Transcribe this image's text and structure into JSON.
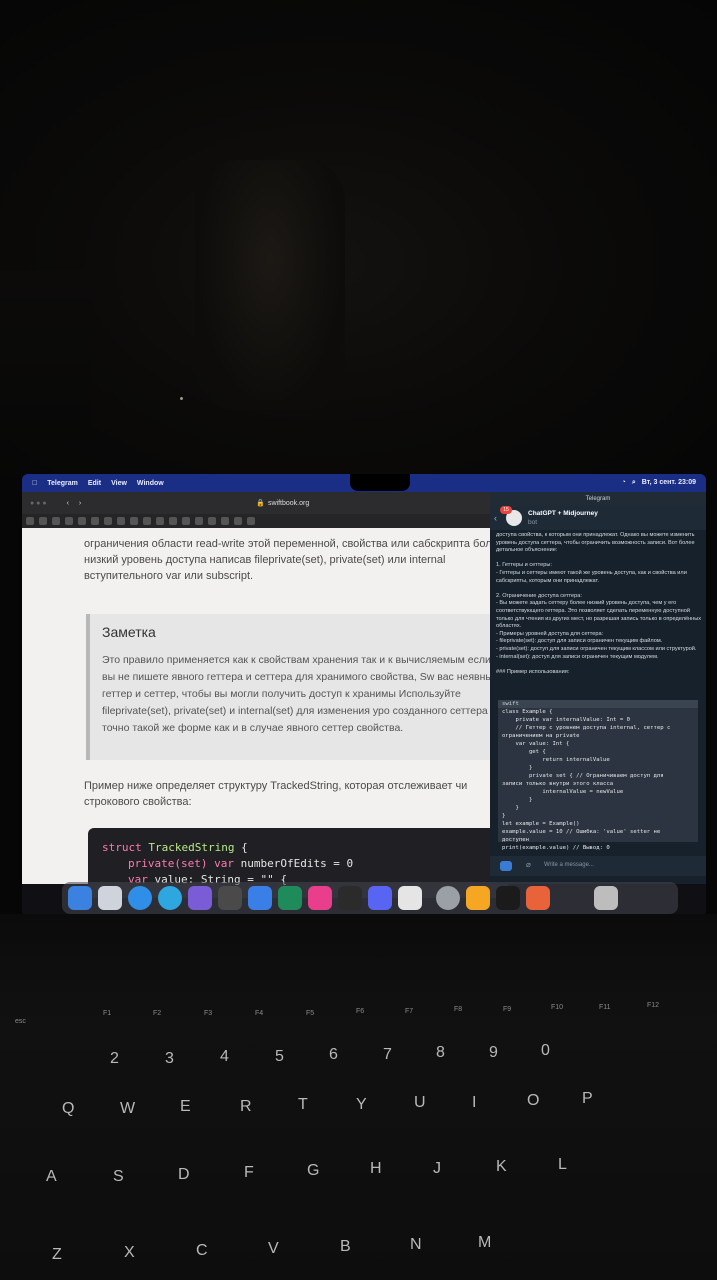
{
  "menubar": {
    "app": "Telegram",
    "items": [
      "Edit",
      "View",
      "Window"
    ],
    "clock": "Вт, 3 сент.  23:09"
  },
  "browser": {
    "url": "swiftbook.org",
    "paragraph1": "ограничения области read-write этой переменной, свойства или сабскрипта более низкий уровень доступа написав fileprivate(set), private(set) или internal вступительного var или subscript.",
    "note_title": "Заметка",
    "note_body": "Это правило применяется как к свойствам хранения так и к вычисляемым если вы не пишете явного геттера и сеттера для хранимого свойства, Sw вас неявный геттер и сеттер, чтобы вы могли получить доступ к хранимы Используйте fileprivate(set), private(set) и internal(set) для изменения уро созданного сеттера в точно такой же форме как и в случае явного сеттер свойства.",
    "paragraph2": "Пример ниже определяет структуру TrackedString, которая отслеживает чи строкового свойства:",
    "code": {
      "line1_kw": "struct",
      "line1_type": "TrackedString",
      "line1_end": "{",
      "line2_kw": "private(set) var",
      "line2_rest": "numberOfEdits = 0",
      "line3_kw": "var",
      "line3_rest": "value: String = \"\" {"
    }
  },
  "telegram": {
    "window_title": "Telegram",
    "chat_name": "ChatGPT + Midjourney",
    "chat_status": "bot",
    "badge": "15",
    "message": "доступа свойства, к которым они принадлежат. Однако вы можете изменить уровень доступа сеттера, чтобы ограничить возможность записи. Вот более детальное объяснение:\n\n1. Геттеры и сеттеры:\n - Геттеры и сеттеры имеют такой же уровень доступа, как и свойства или сабскрипты, которым они принадлежат.\n\n2. Ограничение доступа сеттера:\n - Вы можете задать сеттеру более низкий уровень доступа, чем у его соответствующего геттера. Это позволяет сделать переменную доступной только для чтения из других мест, но разрешая запись только в определённых областях.\n - Примеры уровней доступа для сеттера:\n - fileprivate(set): доступ для записи ограничен текущим файлом.\n - private(set): доступ для записи ограничен текущим классом или структурой.\n - internal(set): доступ для записи ограничен текущим модулем.\n\n### Пример использования:",
    "code_lang": "swift",
    "code_lines": [
      "class Example {",
      "    private var internalValue: Int = 0",
      "",
      "    // Геттер с уровнем доступа internal, сеттер с",
      "ограничением на private",
      "    var value: Int {",
      "        get {",
      "            return internalValue",
      "        }",
      "        private set { // Ограничиваем доступ для",
      "записи только внутри этого класса",
      "            internalValue = newValue",
      "        }",
      "    }",
      "}",
      "",
      "let example = Example()",
      "example.value = 10 // Ошибка: 'value' setter не",
      "доступен",
      "print(example.value) // Вывод: 0"
    ],
    "input_placeholder": "Write a message..."
  },
  "keyboard": {
    "fkeys": [
      "F1",
      "F2",
      "F3",
      "F4",
      "F5",
      "F6",
      "F7",
      "F8",
      "F9",
      "F10",
      "F11",
      "F12"
    ],
    "esc": "esc",
    "numrow": [
      "2",
      "3",
      "4",
      "5",
      "6",
      "7",
      "8",
      "9",
      "0"
    ],
    "row1": [
      "Q",
      "W",
      "E",
      "R",
      "T",
      "Y",
      "U",
      "I",
      "O",
      "P"
    ],
    "row2": [
      "A",
      "S",
      "D",
      "F",
      "G",
      "H",
      "J",
      "K",
      "L"
    ],
    "row3": [
      "Z",
      "X",
      "C",
      "V",
      "B",
      "N",
      "M"
    ]
  },
  "colors": {
    "menubar": "#1b2e86",
    "telegram_bg": "#17212b",
    "code_bg": "#1f1f24"
  }
}
